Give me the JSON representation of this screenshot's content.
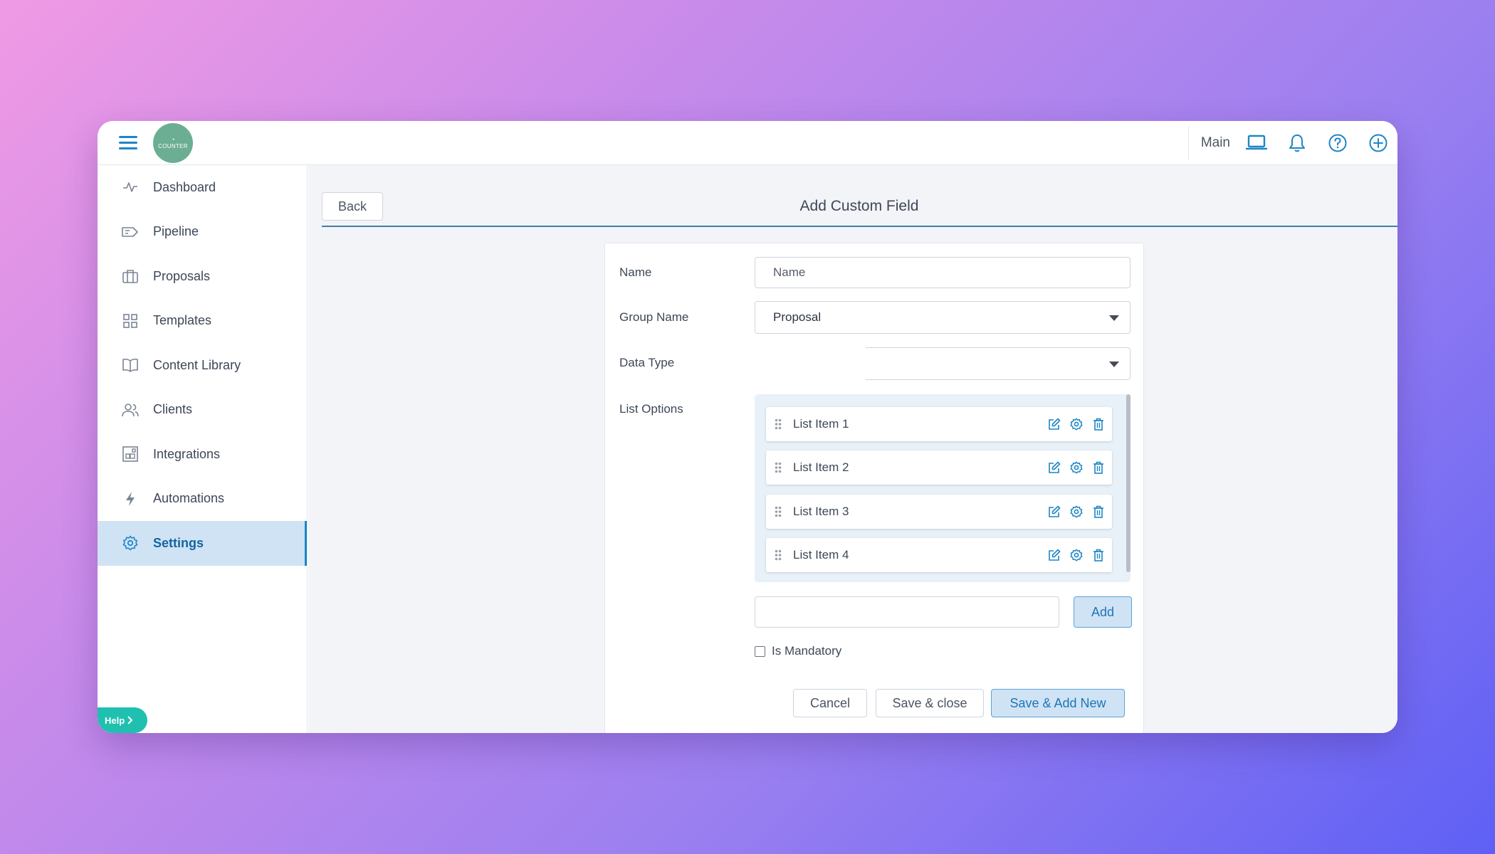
{
  "app": {
    "logo_text": "COUNTER",
    "logo_mark": "◔"
  },
  "topbar": {
    "workspace_label": "Main",
    "icons": [
      "menu-icon",
      "laptop-icon",
      "bell-icon",
      "help-circle-icon",
      "plus-circle-icon"
    ]
  },
  "sidebar": {
    "items": [
      {
        "label": "Dashboard",
        "icon": "activity-icon"
      },
      {
        "label": "Pipeline",
        "icon": "tag-icon"
      },
      {
        "label": "Proposals",
        "icon": "briefcase-icon"
      },
      {
        "label": "Templates",
        "icon": "grid-icon"
      },
      {
        "label": "Content Library",
        "icon": "book-icon"
      },
      {
        "label": "Clients",
        "icon": "users-icon"
      },
      {
        "label": "Integrations",
        "icon": "integration-icon"
      },
      {
        "label": "Automations",
        "icon": "lightning-icon"
      },
      {
        "label": "Settings",
        "icon": "gear-icon",
        "active": true
      }
    ],
    "help_label": "Help"
  },
  "page": {
    "back_label": "Back",
    "title": "Add Custom Field"
  },
  "form": {
    "name_label": "Name",
    "name_placeholder": "Name",
    "name_value": "",
    "group_label": "Group Name",
    "group_value": "Proposal",
    "type_label": "Data Type",
    "type_value": "",
    "list_label": "List Options",
    "list_items": [
      "List Item 1",
      "List Item 2",
      "List Item 3",
      "List Item 4"
    ],
    "new_item_value": "",
    "add_label": "Add",
    "mandatory_label": "Is Mandatory",
    "mandatory_checked": false,
    "cancel_label": "Cancel",
    "save_close_label": "Save & close",
    "save_new_label": "Save & Add New"
  },
  "colors": {
    "accent": "#1e86c6",
    "active_bg": "#cfe3f5",
    "help": "#1fc0b0",
    "logo": "#6cae93"
  }
}
